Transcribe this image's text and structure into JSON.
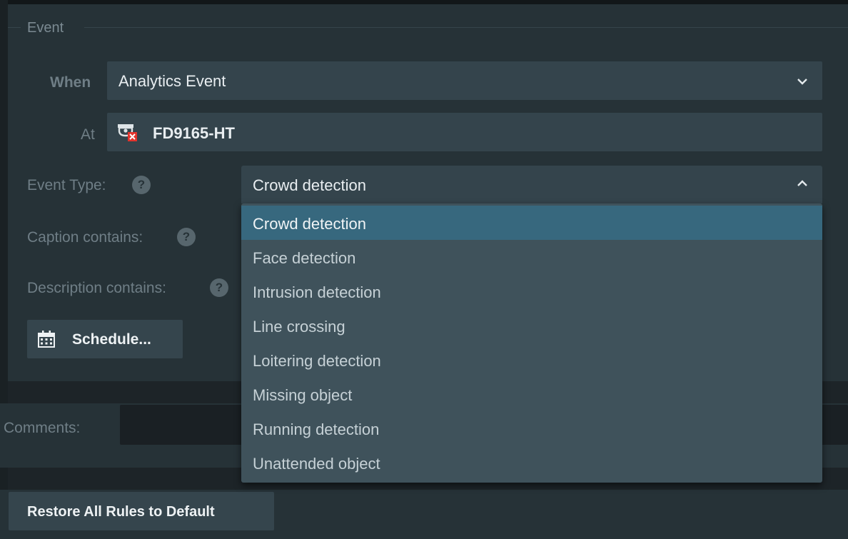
{
  "event_group": {
    "legend": "Event",
    "when_label": "When",
    "when_value": "Analytics Event",
    "at_label": "At",
    "at_value": "FD9165-HT",
    "event_type_label": "Event Type:",
    "event_type_value": "Crowd detection",
    "caption_label": "Caption contains:",
    "description_label": "Description contains:",
    "schedule_label": "Schedule...",
    "help_glyph": "?"
  },
  "event_type_options": [
    {
      "label": "Crowd detection",
      "selected": true
    },
    {
      "label": "Face detection"
    },
    {
      "label": "Intrusion detection"
    },
    {
      "label": "Line crossing"
    },
    {
      "label": "Loitering detection"
    },
    {
      "label": "Missing object"
    },
    {
      "label": "Running detection"
    },
    {
      "label": "Unattended object"
    }
  ],
  "comments_label": "Comments:",
  "restore_button_label": "Restore All Rules to Default",
  "icons": {
    "camera": "camera-offline-icon",
    "calendar": "calendar-icon",
    "chevron_down": "chevron-down-icon",
    "chevron_up": "chevron-up-icon",
    "help": "help-icon"
  },
  "colors": {
    "selected_option": "#37687e",
    "offline_badge": "#e2332c"
  }
}
